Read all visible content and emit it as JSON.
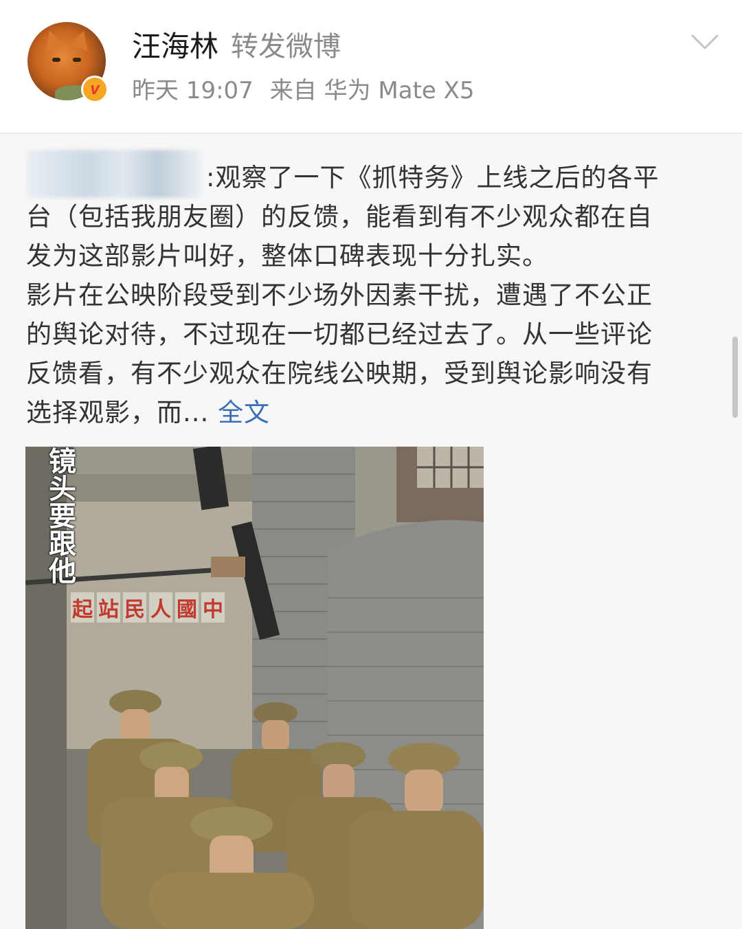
{
  "header": {
    "username": "汪海林",
    "action": "转发微博",
    "time": "昨天 19:07",
    "source": "来自 华为 Mate X5",
    "verified_badge_icon": "verified-v-badge-icon",
    "expand_icon": "chevron-down-icon"
  },
  "post": {
    "lines": [
      ":观察了一下《抓特务》上线之后的各平",
      "台（包括我朋友圈）的反馈，能看到有不少观众都在自",
      "发为这部影片叫好，整体口碑表现十分扎实。",
      "影片在公映阶段受到不少场外因素干扰，遭遇了不公正",
      "的舆论对待，不过现在一切都已经过去了。从一些评论",
      "反馈看，有不少观众在院线公映期，受到舆论影响没有",
      "选择观影，而..."
    ],
    "full_text_link": "全文"
  },
  "image": {
    "caption": "镜头要跟他",
    "slogan": [
      "起",
      "站",
      "民",
      "人",
      "國",
      "中"
    ]
  },
  "colors": {
    "link": "#3a6fb5",
    "text": "#333333",
    "meta": "#8a8a8a",
    "slogan_red": "#c23a2e"
  }
}
